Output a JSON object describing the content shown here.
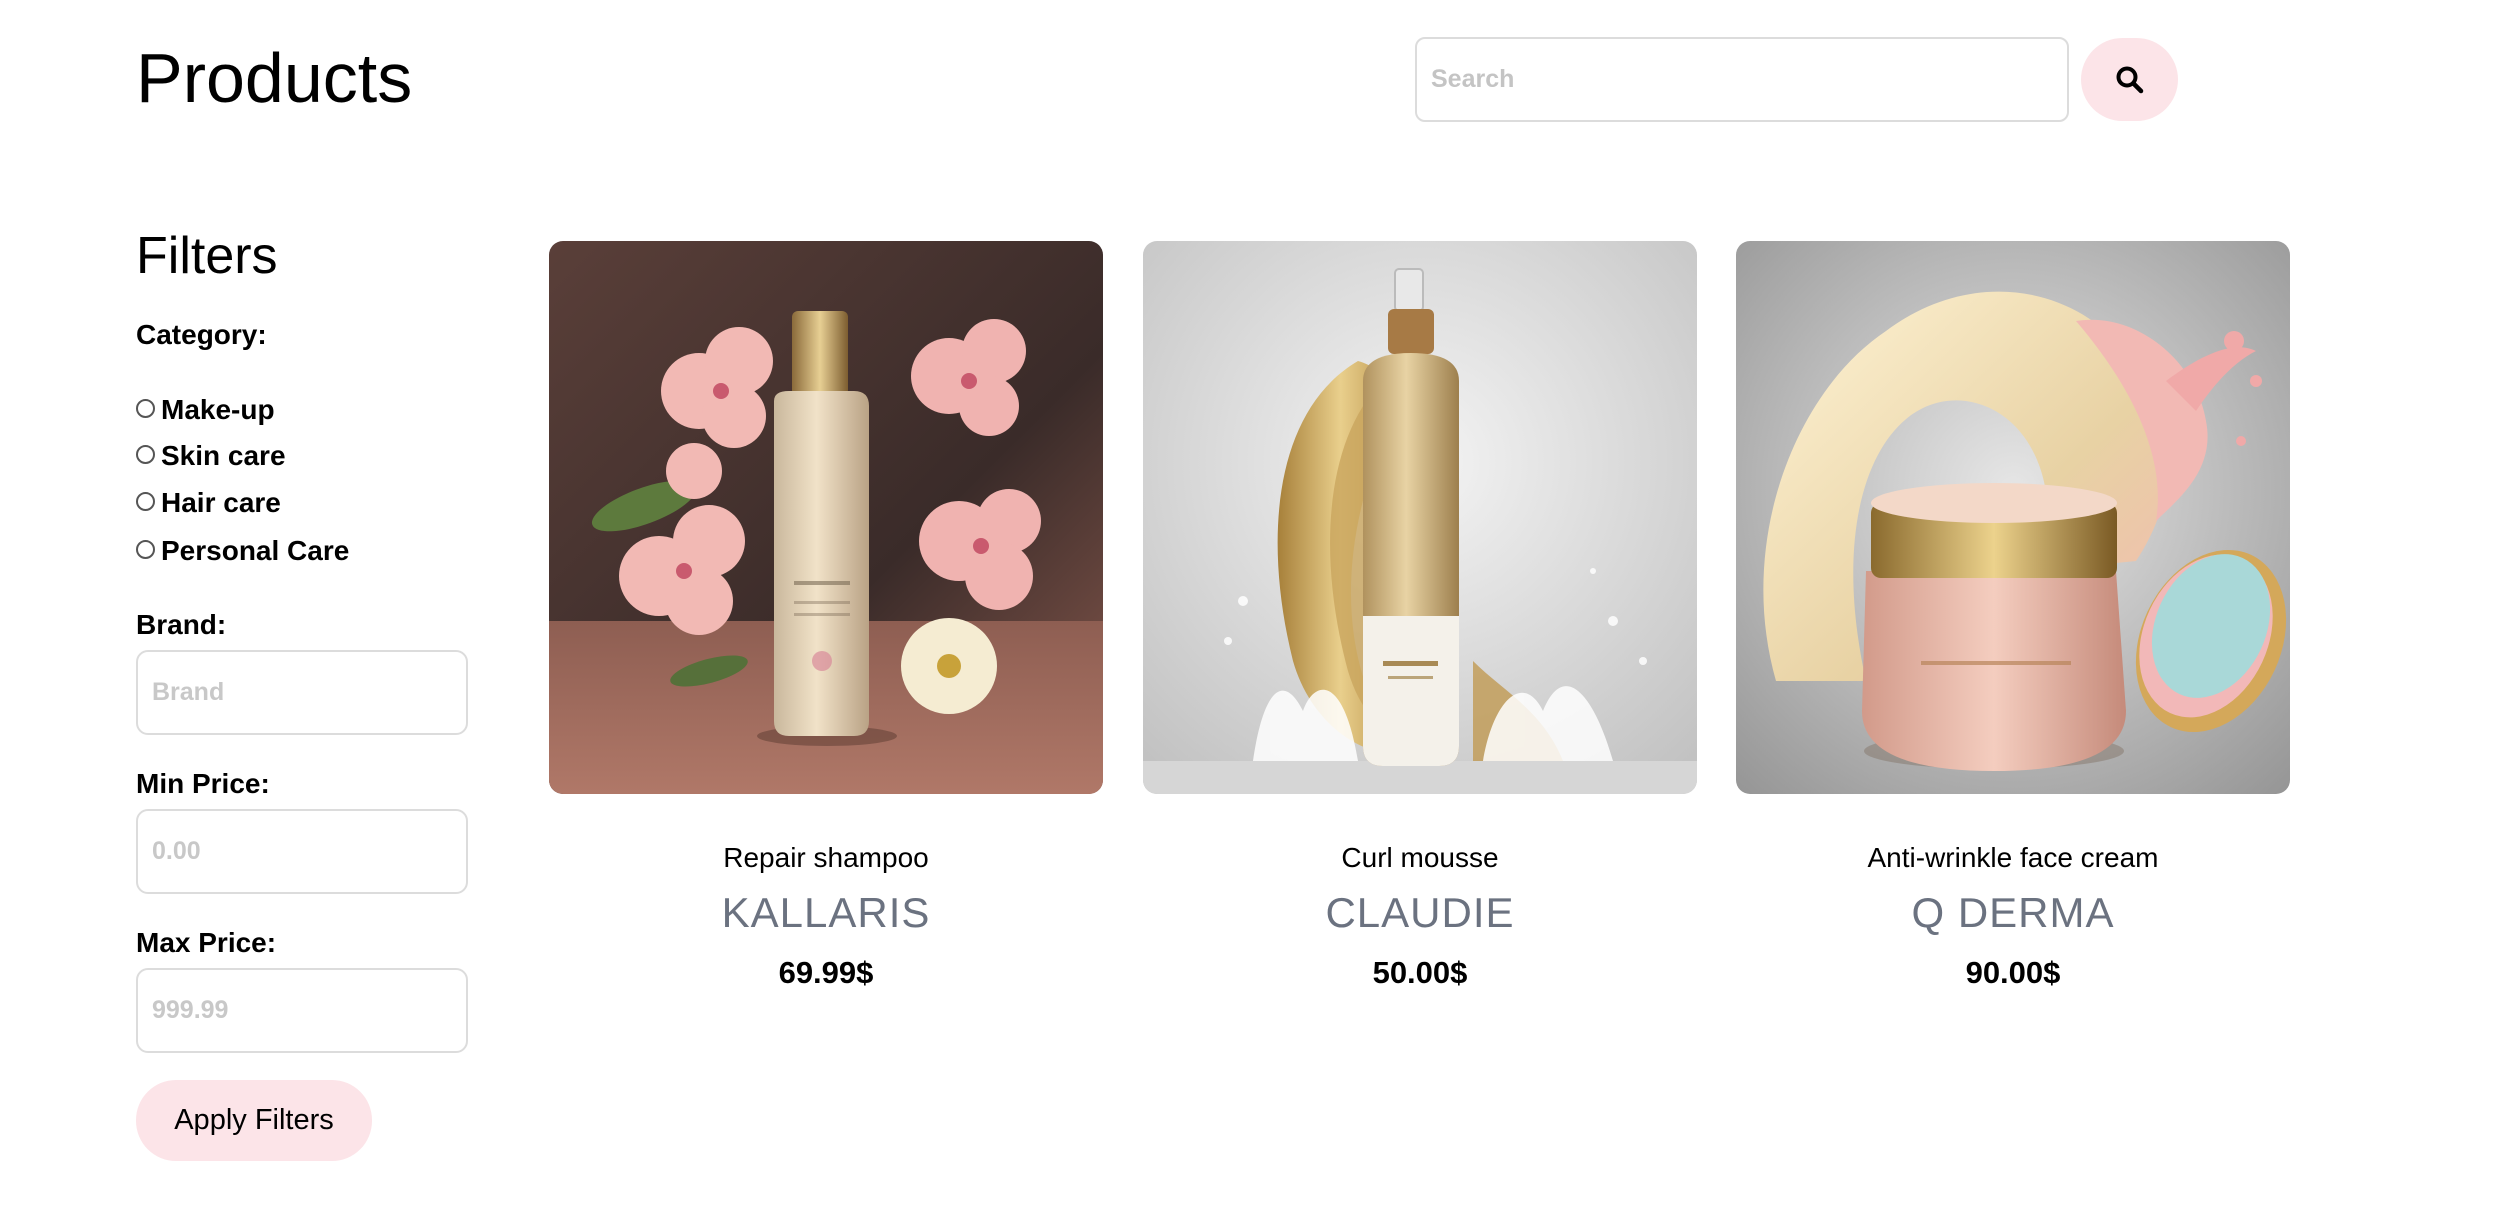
{
  "header": {
    "title": "Products",
    "search_placeholder": "Search",
    "search_icon": "search-icon"
  },
  "filters": {
    "title": "Filters",
    "category_label": "Category:",
    "categories": [
      "Make-up",
      "Skin care",
      "Hair care",
      "Personal Care"
    ],
    "brand_label": "Brand:",
    "brand_placeholder": "Brand",
    "min_price_label": "Min Price:",
    "min_price_placeholder": "0.00",
    "max_price_label": "Max Price:",
    "max_price_placeholder": "999.99",
    "apply_label": "Apply Filters"
  },
  "products": [
    {
      "name": "Repair shampoo",
      "brand": "KALLARIS",
      "price": "69.99$"
    },
    {
      "name": "Curl mousse",
      "brand": "CLAUDIE",
      "price": "50.00$"
    },
    {
      "name": "Anti-wrinkle face cream",
      "brand": "Q DERMA",
      "price": "90.00$"
    }
  ],
  "colors": {
    "accent_pink": "#fce4e8",
    "brand_gray": "#6b7280"
  }
}
